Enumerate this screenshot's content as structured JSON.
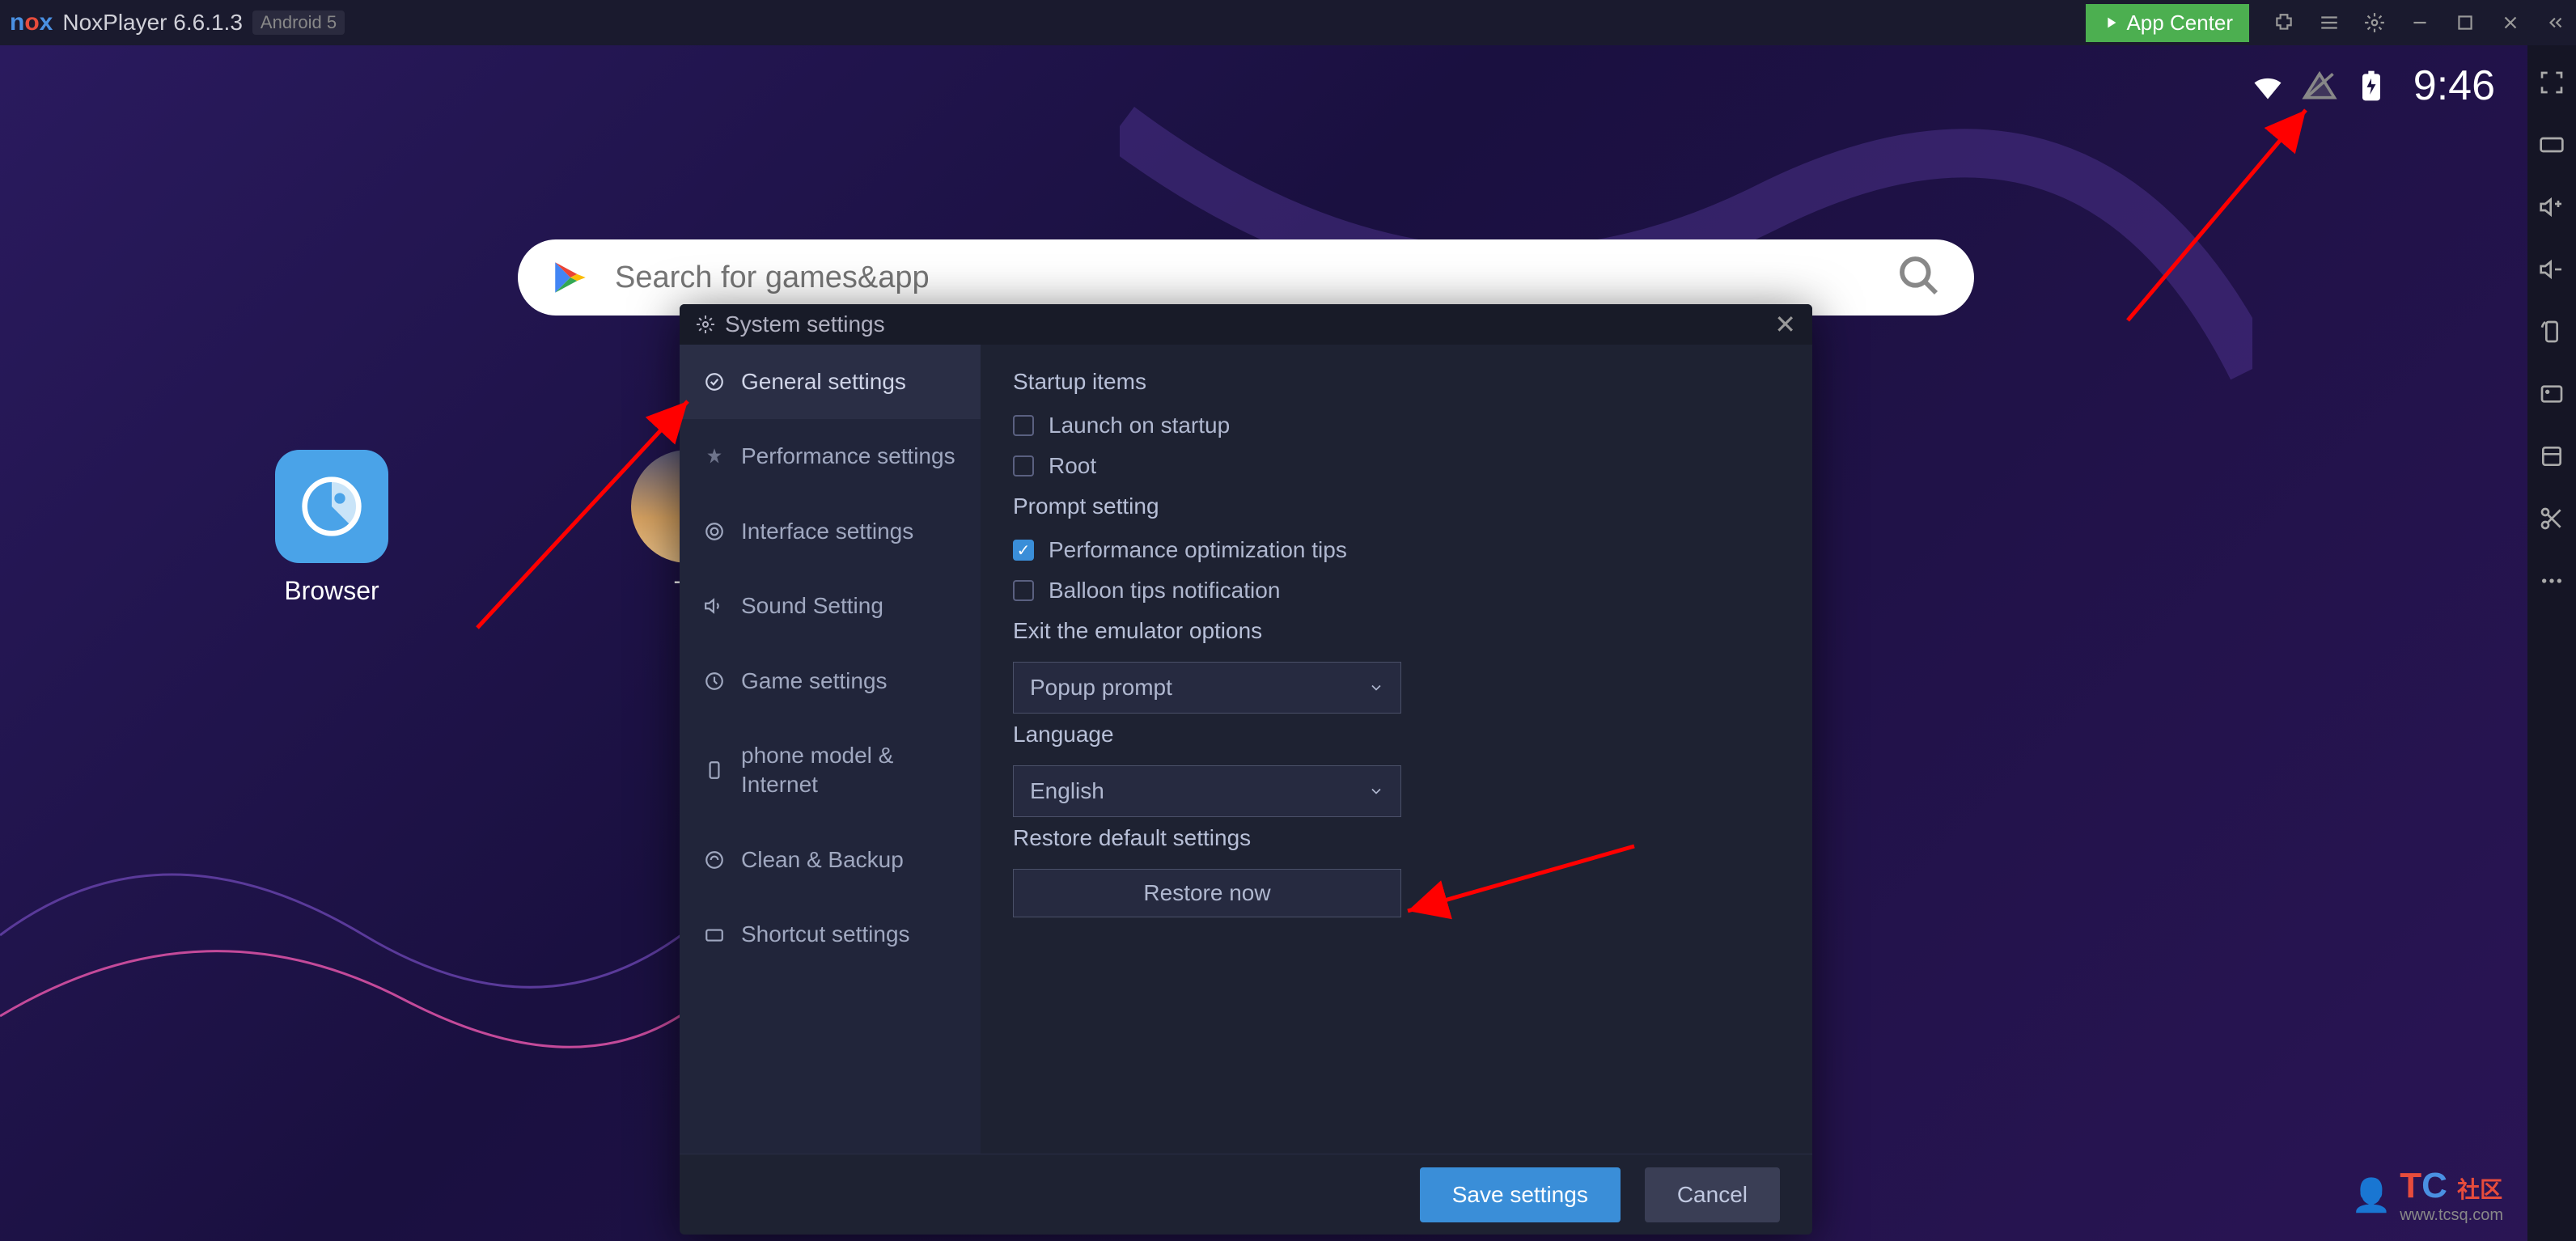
{
  "titlebar": {
    "app_name": "NoxPlayer 6.6.1.3",
    "android_badge": "Android 5",
    "app_center": "App Center"
  },
  "statusbar": {
    "time": "9:46"
  },
  "search": {
    "placeholder": "Search for games&app"
  },
  "desktop": {
    "browser_label": "Browser",
    "tool_label": "To"
  },
  "dialog": {
    "title": "System settings",
    "sidebar": {
      "general": "General settings",
      "performance": "Performance settings",
      "interface": "Interface settings",
      "sound": "Sound Setting",
      "game": "Game settings",
      "phone": "phone model & Internet",
      "clean": "Clean & Backup",
      "shortcut": "Shortcut settings"
    },
    "content": {
      "startup_title": "Startup items",
      "launch_startup": "Launch on startup",
      "root": "Root",
      "prompt_title": "Prompt setting",
      "perf_tips": "Performance optimization tips",
      "balloon_tips": "Balloon tips notification",
      "exit_title": "Exit the emulator options",
      "exit_value": "Popup prompt",
      "language_title": "Language",
      "language_value": "English",
      "restore_title": "Restore default settings",
      "restore_btn": "Restore now"
    },
    "footer": {
      "save": "Save settings",
      "cancel": "Cancel"
    }
  },
  "watermark": {
    "badge": "社区"
  }
}
